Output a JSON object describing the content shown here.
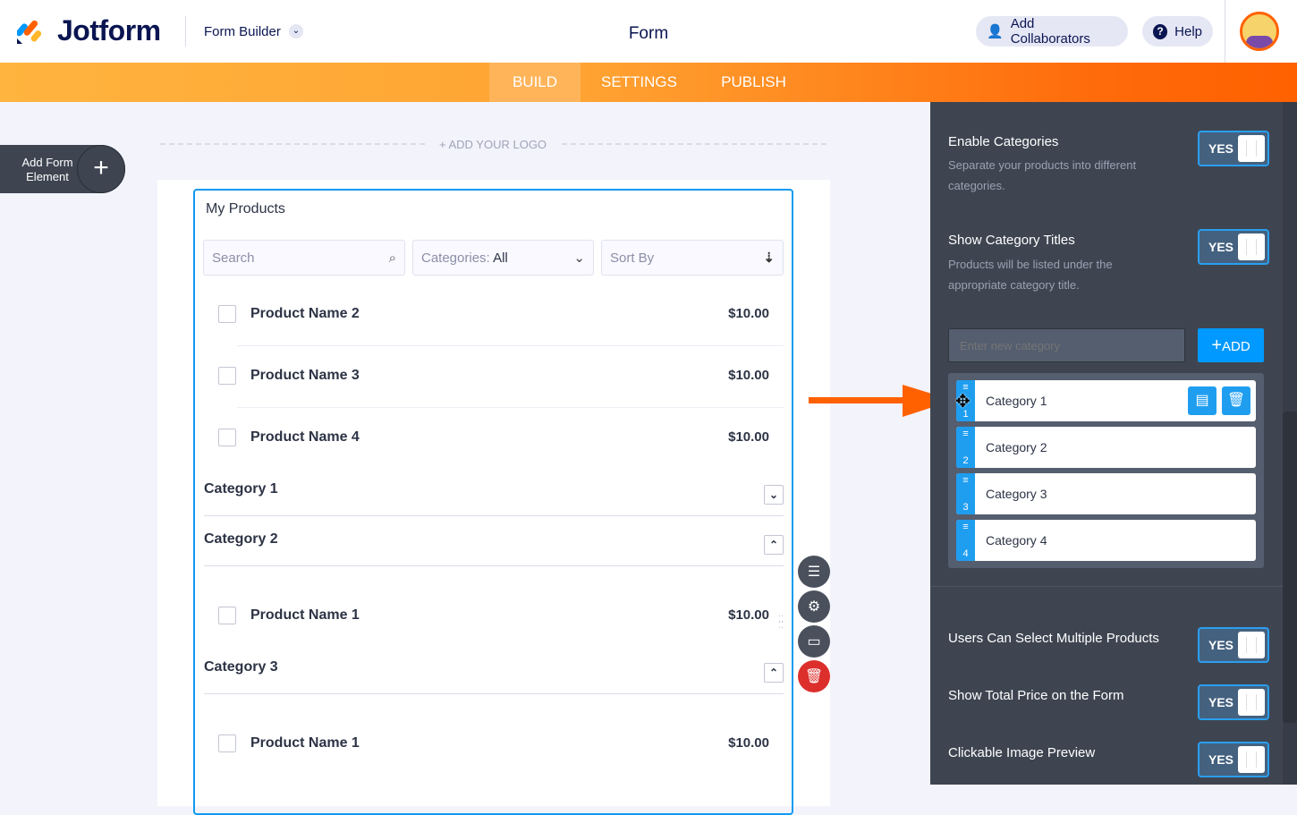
{
  "header": {
    "logo": "Jotform",
    "app_switcher": "Form Builder",
    "title": "Form",
    "add_collaborators": "Add Collaborators",
    "help": "Help"
  },
  "tabs": [
    "BUILD",
    "SETTINGS",
    "PUBLISH"
  ],
  "canvas": {
    "add_form_element": "Add Form Element",
    "add_logo": "+ ADD YOUR LOGO"
  },
  "widget": {
    "title": "My Products",
    "search_placeholder": "Search",
    "categories_label": "Categories:",
    "categories_value": "All",
    "sort_placeholder": "Sort By",
    "top_products": [
      {
        "name": "Product Name 2",
        "price": "$10.00"
      },
      {
        "name": "Product Name 3",
        "price": "$10.00"
      },
      {
        "name": "Product Name 4",
        "price": "$10.00"
      }
    ],
    "categories": [
      {
        "name": "Category 1",
        "expanded": false
      },
      {
        "name": "Category 2",
        "expanded": true,
        "product": {
          "name": "Product Name 1",
          "price": "$10.00"
        }
      },
      {
        "name": "Category 3",
        "expanded": true,
        "product": {
          "name": "Product Name 1",
          "price": "$10.00"
        }
      }
    ]
  },
  "panel": {
    "enable_categories": {
      "label": "Enable Categories",
      "desc": "Separate your products into different categories.",
      "value": "YES"
    },
    "show_titles": {
      "label": "Show Category Titles",
      "desc": "Products will be listed under the appropriate category title.",
      "value": "YES"
    },
    "new_category_placeholder": "Enter new category",
    "add_button": "ADD",
    "category_list": [
      {
        "n": "1",
        "name": "Category 1"
      },
      {
        "n": "2",
        "name": "Category 2"
      },
      {
        "n": "3",
        "name": "Category 3"
      },
      {
        "n": "4",
        "name": "Category 4"
      }
    ],
    "multi": {
      "label": "Users Can Select Multiple Products",
      "value": "YES"
    },
    "total": {
      "label": "Show Total Price on the Form",
      "value": "YES"
    },
    "preview": {
      "label": "Clickable Image Preview",
      "value": "YES"
    }
  },
  "colors": {
    "accent": "#ff6100",
    "blue": "#1f9ef0",
    "panel": "#3e4551"
  }
}
